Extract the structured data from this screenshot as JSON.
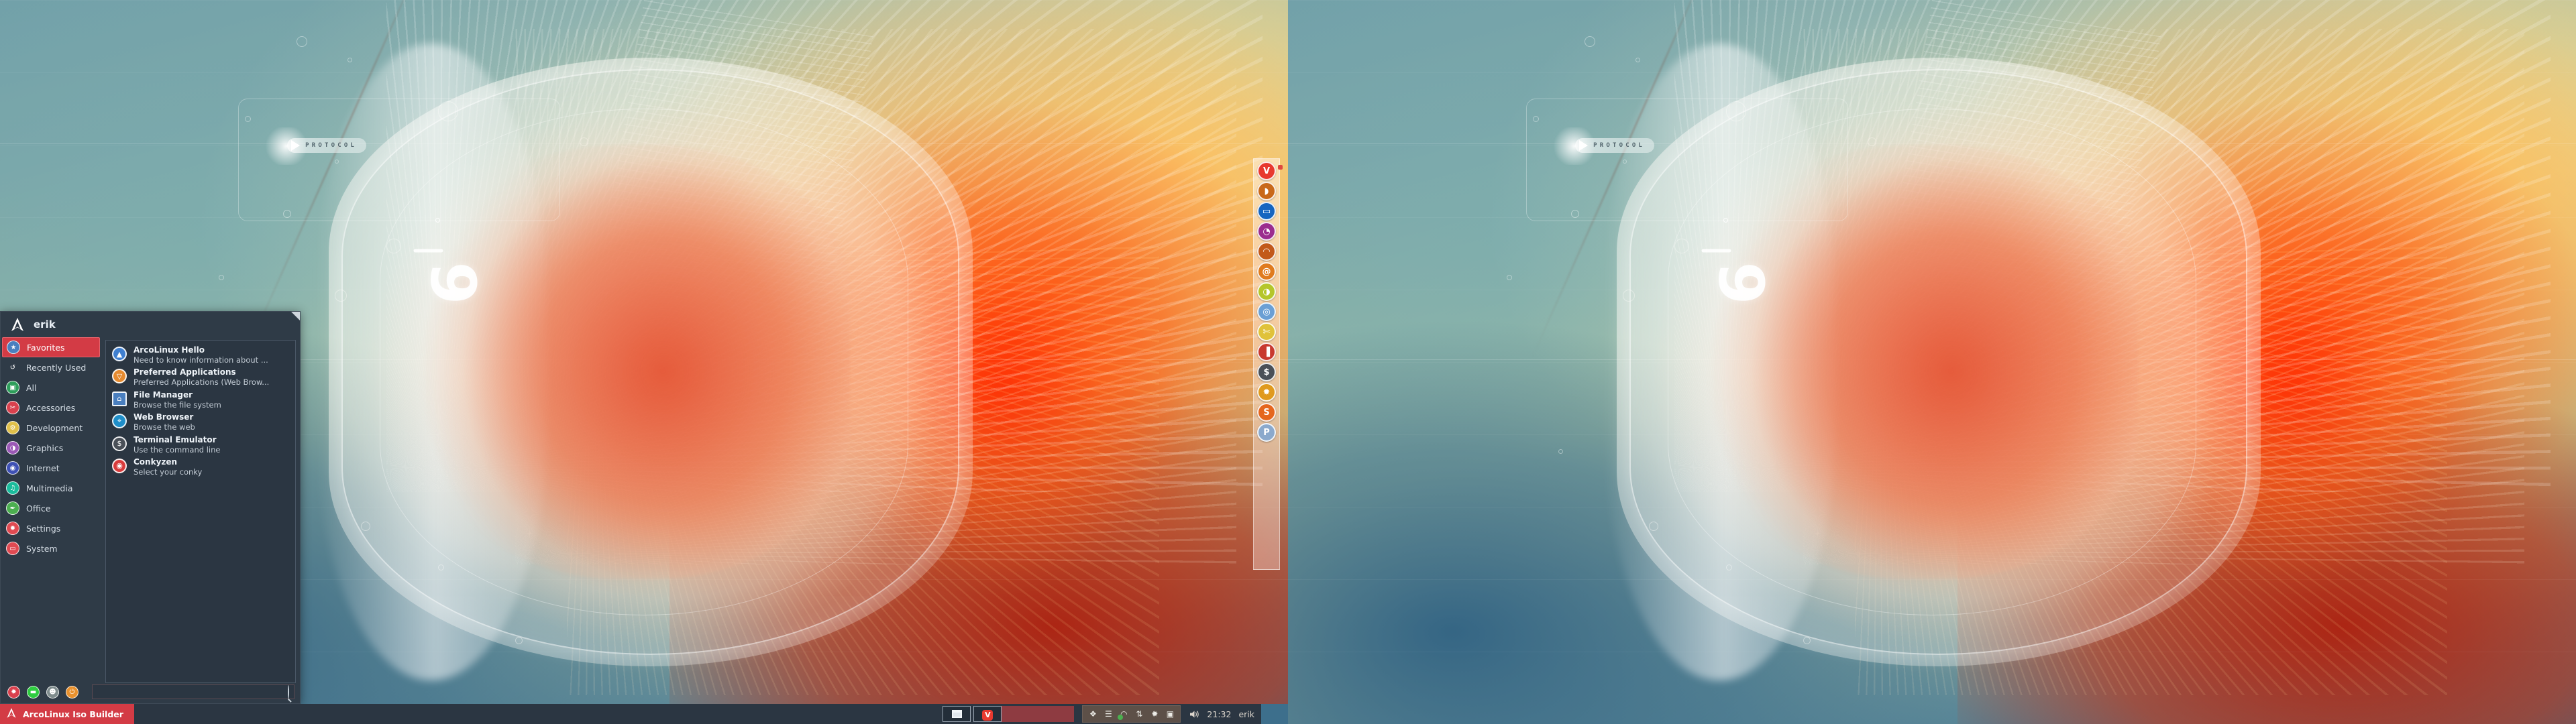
{
  "desktop": {
    "wallpaper": {
      "name": "arcolinux-protocol-wallpaper",
      "brand_text": "PROTOCOL",
      "mark": "9",
      "accent_warm": "#e8502a",
      "accent_cool": "#3d6f8c"
    },
    "monitors": [
      "primary",
      "secondary"
    ]
  },
  "whisker_menu": {
    "username": "erik",
    "logo_icon": "arch-logo-icon",
    "resize_grip_icon": "resize-grip-icon",
    "categories": [
      {
        "label": "Favorites",
        "icon": "favorites-folder-icon",
        "glyph": "★",
        "color": "#4a7fbf",
        "selected": true
      },
      {
        "label": "Recently Used",
        "icon": "history-clock-icon",
        "glyph": "↺",
        "color": "#00000000",
        "selected": false
      },
      {
        "label": "All",
        "icon": "all-apps-icon",
        "glyph": "▣",
        "color": "#2e9e5b",
        "selected": false
      },
      {
        "label": "Accessories",
        "icon": "accessories-icon",
        "glyph": "✂",
        "color": "#d9414e",
        "selected": false
      },
      {
        "label": "Development",
        "icon": "development-icon",
        "glyph": "⚙",
        "color": "#e0c04a",
        "selected": false
      },
      {
        "label": "Graphics",
        "icon": "graphics-palette-icon",
        "glyph": "◑",
        "color": "#9b59b6",
        "selected": false
      },
      {
        "label": "Internet",
        "icon": "internet-globe-icon",
        "glyph": "◉",
        "color": "#3f51b5",
        "selected": false
      },
      {
        "label": "Multimedia",
        "icon": "multimedia-icon",
        "glyph": "♫",
        "color": "#1abc9c",
        "selected": false
      },
      {
        "label": "Office",
        "icon": "office-icon",
        "glyph": "✒",
        "color": "#4caf50",
        "selected": false
      },
      {
        "label": "Settings",
        "icon": "settings-gear-icon",
        "glyph": "✹",
        "color": "#e04a52",
        "selected": false
      },
      {
        "label": "System",
        "icon": "system-monitor-icon",
        "glyph": "▭",
        "color": "#e04a52",
        "selected": false
      }
    ],
    "apps": [
      {
        "name": "ArcoLinux Hello",
        "desc": "Need to know information about ...",
        "icon": "arcolinux-hello-icon",
        "glyph": "▲",
        "color": "#3f7fd0",
        "square": false
      },
      {
        "name": "Preferred Applications",
        "desc": "Preferred Applications (Web Brow...",
        "icon": "preferred-apps-icon",
        "glyph": "▽",
        "color": "#e68a2e",
        "square": false
      },
      {
        "name": "File Manager",
        "desc": "Browse the file system",
        "icon": "file-manager-icon",
        "glyph": "⌂",
        "color": "#4a7fbf",
        "square": true
      },
      {
        "name": "Web Browser",
        "desc": "Browse the web",
        "icon": "web-browser-icon",
        "glyph": "⌖",
        "color": "#1f8ec9",
        "square": false
      },
      {
        "name": "Terminal Emulator",
        "desc": "Use the command line",
        "icon": "terminal-icon",
        "glyph": "$",
        "color": "#4a5058",
        "square": false
      },
      {
        "name": "Conkyzen",
        "desc": "Select your conky",
        "icon": "conkyzen-icon",
        "glyph": "◉",
        "color": "#d93b3b",
        "square": false
      }
    ],
    "footer_buttons": [
      {
        "name": "settings-manager-button",
        "icon": "gear-icon",
        "glyph": "✹",
        "color": "#d9414e"
      },
      {
        "name": "lock-screen-button",
        "icon": "lock-icon",
        "glyph": "▬",
        "color": "#2ecc40"
      },
      {
        "name": "switch-user-button",
        "icon": "users-icon",
        "glyph": "☻",
        "color": "#7f8c8d"
      },
      {
        "name": "logout-button",
        "icon": "power-icon",
        "glyph": "⏻",
        "color": "#e8912e"
      }
    ],
    "search": {
      "value": "",
      "placeholder": "",
      "icon": "search-icon"
    }
  },
  "dock": {
    "name": "plank-dock",
    "items": [
      {
        "name": "vivaldi",
        "icon": "vivaldi-icon",
        "glyph": "V",
        "color": "#e8392f",
        "badge": true
      },
      {
        "name": "firefox",
        "icon": "firefox-icon",
        "glyph": "◗",
        "color": "#c9691a",
        "badge": false
      },
      {
        "name": "file-manager",
        "icon": "file-manager-icon",
        "glyph": "▭",
        "color": "#1565c0",
        "badge": false
      },
      {
        "name": "gimp",
        "icon": "gimp-icon",
        "glyph": "◔",
        "color": "#9b2d8e",
        "badge": false
      },
      {
        "name": "inkscape",
        "icon": "inkscape-icon",
        "glyph": "◠",
        "color": "#c2591a",
        "badge": false
      },
      {
        "name": "krita",
        "icon": "krita-icon",
        "glyph": "@",
        "color": "#e07b1e",
        "badge": false
      },
      {
        "name": "genie",
        "icon": "genie-lamp-icon",
        "glyph": "◑",
        "color": "#b5c62a",
        "badge": false
      },
      {
        "name": "chromium",
        "icon": "chromium-icon",
        "glyph": "◎",
        "color": "#6b9fd4",
        "badge": false
      },
      {
        "name": "variety",
        "icon": "variety-icon",
        "glyph": "✄",
        "color": "#e0c23a",
        "badge": false
      },
      {
        "name": "vlc-colors",
        "icon": "media-colors-icon",
        "glyph": "▐",
        "color": "#c8392f",
        "badge": false
      },
      {
        "name": "terminal",
        "icon": "terminal-icon",
        "glyph": "$",
        "color": "#4a5058",
        "badge": false
      },
      {
        "name": "settings",
        "icon": "settings-gear-icon",
        "glyph": "✹",
        "color": "#e09a1e",
        "badge": false
      },
      {
        "name": "skype",
        "icon": "skype-icon",
        "glyph": "S",
        "color": "#e5661e",
        "badge": false
      },
      {
        "name": "pamac",
        "icon": "pamac-icon",
        "glyph": "P",
        "color": "#8ba9cc",
        "badge": false
      }
    ]
  },
  "taskbar": {
    "launcher": {
      "label": "ArcoLinux Iso Builder",
      "icon": "arch-logo-icon",
      "color": "#d33b45"
    },
    "windows": [
      {
        "name": "window-button-generic",
        "icon": "window-icon",
        "glyph": "▣",
        "active": false
      },
      {
        "name": "window-button-vivaldi",
        "icon": "vivaldi-icon",
        "glyph": "V",
        "active": false
      }
    ],
    "active_window_placeholder": "",
    "tray": [
      {
        "name": "dropbox",
        "icon": "dropbox-icon",
        "glyph": "❖"
      },
      {
        "name": "clipboard",
        "icon": "clipboard-icon",
        "glyph": "☰"
      },
      {
        "name": "wifi",
        "icon": "wifi-icon",
        "glyph": "◠"
      },
      {
        "name": "network",
        "icon": "network-updown-icon",
        "glyph": "⇅"
      },
      {
        "name": "settings",
        "icon": "gear-icon",
        "glyph": "✹"
      },
      {
        "name": "wallpaper",
        "icon": "image-icon",
        "glyph": "▣"
      }
    ],
    "volume": {
      "name": "volume",
      "icon": "speaker-icon",
      "glyph": "◂"
    },
    "clock": "21:32",
    "user": "erik"
  }
}
